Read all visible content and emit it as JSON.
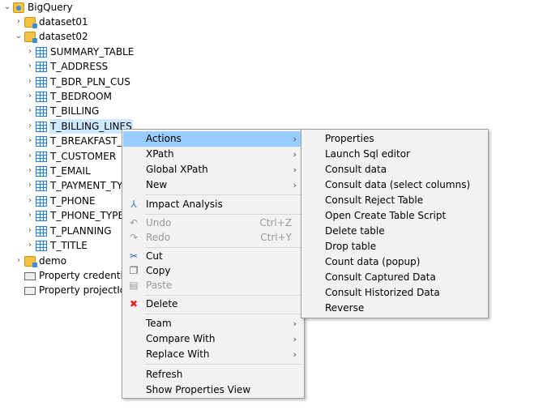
{
  "tree": {
    "root": "BigQuery",
    "datasets": [
      {
        "label": "dataset01",
        "expanded": false
      },
      {
        "label": "dataset02",
        "expanded": true
      }
    ],
    "tables": [
      "SUMMARY_TABLE",
      "T_ADDRESS",
      "T_BDR_PLN_CUS",
      "T_BEDROOM",
      "T_BILLING",
      "T_BILLING_LINES",
      "T_BREAKFAST_PI",
      "T_CUSTOMER",
      "T_EMAIL",
      "T_PAYMENT_TYP",
      "T_PHONE",
      "T_PHONE_TYPE",
      "T_PLANNING",
      "T_TITLE"
    ],
    "demo": "demo",
    "properties": [
      "Property credential",
      "Property projectId"
    ]
  },
  "context_menu": {
    "actions": "Actions",
    "xpath": "XPath",
    "global_xpath": "Global XPath",
    "new": "New",
    "impact_analysis": "Impact Analysis",
    "undo": "Undo",
    "undo_shortcut": "Ctrl+Z",
    "redo": "Redo",
    "redo_shortcut": "Ctrl+Y",
    "cut": "Cut",
    "copy": "Copy",
    "paste": "Paste",
    "delete": "Delete",
    "team": "Team",
    "compare_with": "Compare With",
    "replace_with": "Replace With",
    "refresh": "Refresh",
    "show_properties_view": "Show Properties View"
  },
  "actions_submenu": [
    "Properties",
    "Launch Sql editor",
    "Consult data",
    "Consult data (select columns)",
    "Consult Reject Table",
    "Open Create Table Script",
    "Delete table",
    "Drop table",
    "Count data (popup)",
    "Consult Captured Data",
    "Consult Historized Data",
    "Reverse"
  ]
}
